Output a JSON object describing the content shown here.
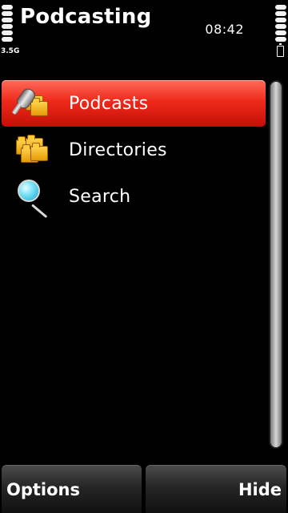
{
  "status": {
    "app_title": "Podcasting",
    "time": "08:42",
    "network": "3.5G",
    "signal_icon": "signal-strength-icon",
    "battery_icon": "battery-icon"
  },
  "menu": {
    "items": [
      {
        "label": "Podcasts",
        "icon": "podcast-folder-icon",
        "selected": true
      },
      {
        "label": "Directories",
        "icon": "folders-icon",
        "selected": false
      },
      {
        "label": "Search",
        "icon": "magnifier-icon",
        "selected": false
      }
    ]
  },
  "softkeys": {
    "left": "Options",
    "right": "Hide"
  },
  "colors": {
    "selection": "#e8241a",
    "background": "#000000"
  }
}
